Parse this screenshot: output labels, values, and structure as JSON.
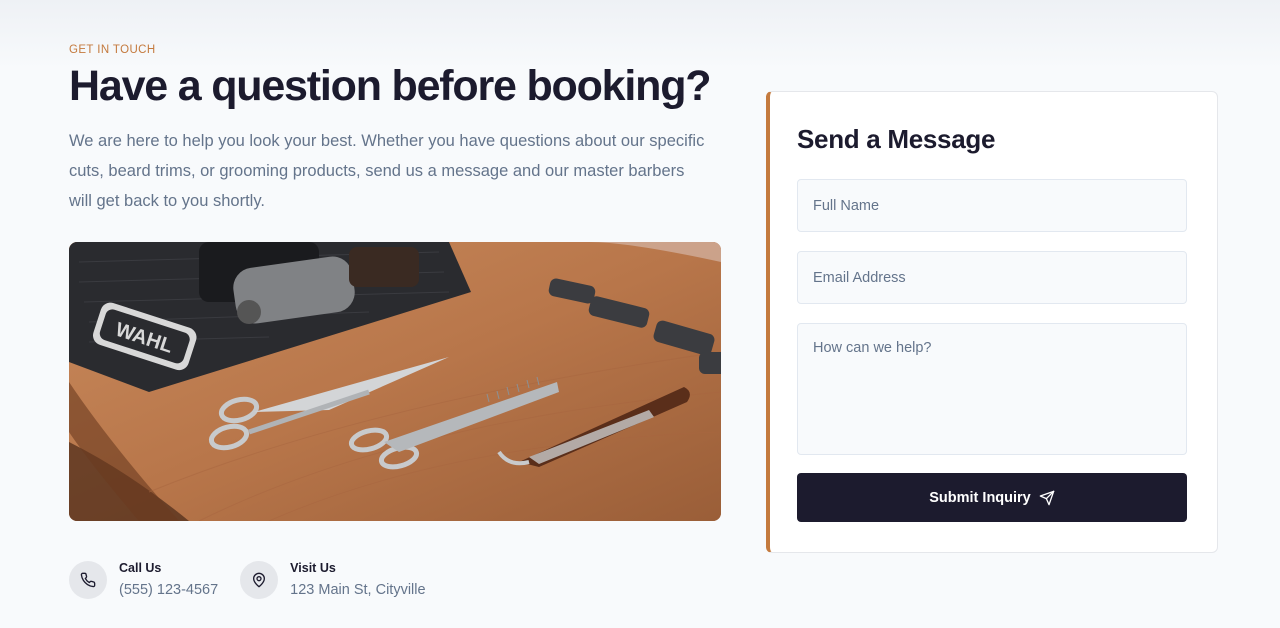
{
  "header": {
    "eyebrow": "GET IN TOUCH",
    "title": "Have a question before booking?",
    "lead": "We are here to help you look your best. Whether you have questions about our specific cuts, beard trims, or grooming products, send us a message and our master barbers will get back to you shortly."
  },
  "image": {
    "alt_text": "WAHL"
  },
  "contacts": [
    {
      "icon": "phone-icon",
      "label": "Call Us",
      "value": "(555) 123-4567"
    },
    {
      "icon": "map-pin-icon",
      "label": "Visit Us",
      "value": "123 Main St, Cityville"
    }
  ],
  "form": {
    "title": "Send a Message",
    "name_placeholder": "Full Name",
    "email_placeholder": "Email Address",
    "message_placeholder": "How can we help?",
    "submit_label": "Submit Inquiry",
    "submit_icon": "send-icon"
  },
  "colors": {
    "accent": "#c47a3e",
    "dark": "#1c1b2e",
    "muted": "#64748b",
    "background": "#f8fafc"
  }
}
